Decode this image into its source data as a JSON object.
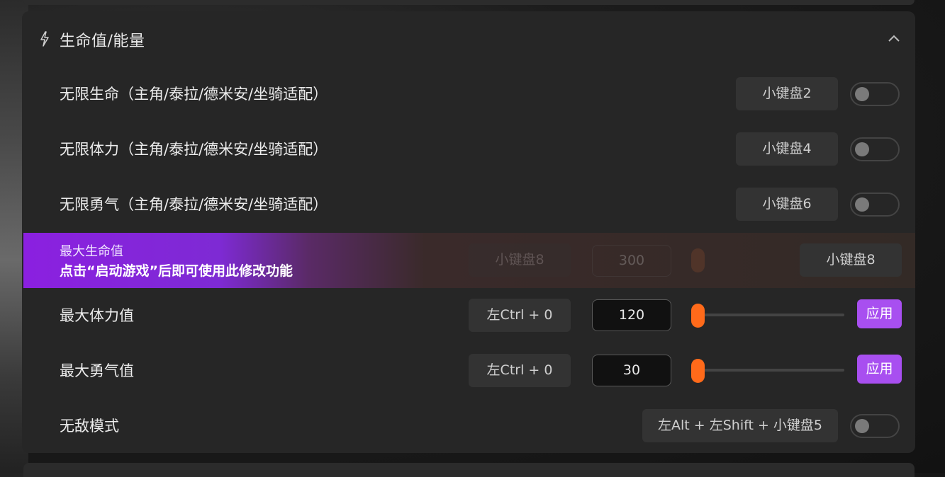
{
  "section": {
    "title": "生命值/能量",
    "icon": "lightning-icon",
    "collapse_icon": "chevron-up-icon"
  },
  "rows": [
    {
      "label": "无限生命（主角/泰拉/德米安/坐骑适配）",
      "hotkey": "小键盘2",
      "enabled": false
    },
    {
      "label": "无限体力（主角/泰拉/德米安/坐骑适配）",
      "hotkey": "小键盘4",
      "enabled": false
    },
    {
      "label": "无限勇气（主角/泰拉/德米安/坐骑适配）",
      "hotkey": "小键盘6",
      "enabled": false
    }
  ],
  "locked": {
    "title": "最大生命值",
    "message": "点击“启动游戏”后即可使用此修改功能",
    "ghost_hotkey": "小键盘8",
    "ghost_value": "300",
    "hotkey": "小键盘8"
  },
  "value_rows": [
    {
      "label": "最大体力值",
      "hotkey": "左Ctrl + 0",
      "value": "120",
      "apply_label": "应用"
    },
    {
      "label": "最大勇气值",
      "hotkey": "左Ctrl + 0",
      "value": "30",
      "apply_label": "应用"
    }
  ],
  "god_mode": {
    "label": "无敌模式",
    "hotkey": "左Alt + 左Shift + 小键盘5",
    "enabled": false
  },
  "colors": {
    "accent": "#a84ff0",
    "slider": "#ff6a1a",
    "panel": "#262626"
  }
}
